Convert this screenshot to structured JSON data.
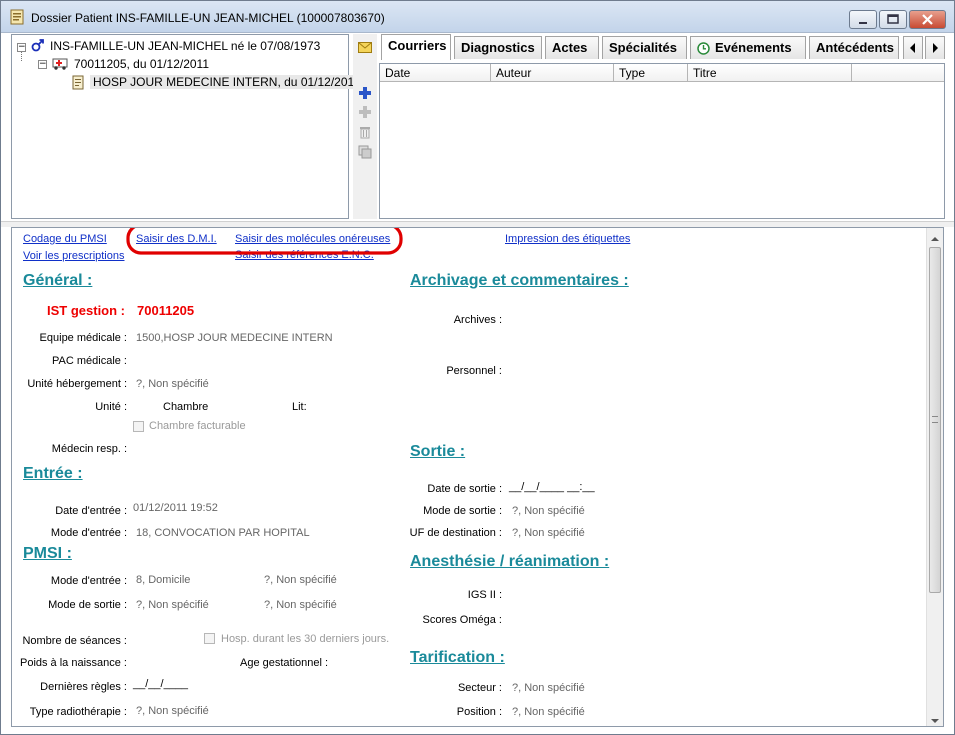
{
  "window": {
    "title": "Dossier Patient INS-FAMILLE-UN JEAN-MICHEL (100007803670)"
  },
  "tree": {
    "patient": "INS-FAMILLE-UN JEAN-MICHEL né le 07/08/1973",
    "stay": "70011205, du 01/12/2011",
    "unit": "HOSP JOUR MEDECINE INTERN, du 01/12/2011"
  },
  "tabs": [
    "Courriers",
    "Diagnostics",
    "Actes",
    "Spécialités",
    "Evénements",
    "Antécédents"
  ],
  "grid": {
    "columns": [
      "Date",
      "Auteur",
      "Type",
      "Titre"
    ]
  },
  "links": {
    "codage_pmsi": "Codage du PMSI",
    "voir_prescriptions": "Voir les prescriptions",
    "saisir_dmi": "Saisir des D.M.I.",
    "saisir_molecules": "Saisir des molécules onéreuses",
    "saisir_references": "Saisir des références E.N.C.",
    "impression_etiquettes": "Impression des étiquettes"
  },
  "general": {
    "heading": "Général :",
    "ist_label": "IST gestion :",
    "ist_value": "70011205",
    "equipe_label": "Equipe médicale :",
    "equipe_value": "1500,HOSP JOUR MEDECINE INTERN",
    "pac_label": "PAC médicale :",
    "unite_heb_label": "Unité hébergement :",
    "unite_heb_value": "?, Non spécifié",
    "unite_label": "Unité :",
    "unite_value": "Chambre",
    "lit_label": "Lit:",
    "chambre_facturable": "Chambre facturable",
    "medecin_label": "Médecin resp. :"
  },
  "entree": {
    "heading": "Entrée :",
    "date_label": "Date d'entrée :",
    "date_value": "01/12/2011 19:52",
    "mode_label": "Mode d'entrée :",
    "mode_value": "18, CONVOCATION PAR HOPITAL"
  },
  "pmsi": {
    "heading": "PMSI :",
    "mode_entree_label": "Mode d'entrée :",
    "mode_entree_value": "8, Domicile",
    "mode_entree_value2": "?, Non spécifié",
    "mode_sortie_label": "Mode de sortie :",
    "mode_sortie_value": "?, Non spécifié",
    "mode_sortie_value2": "?, Non spécifié",
    "seances_label": "Nombre de séances :",
    "hosp_30_label": "Hosp. durant les 30 derniers jours.",
    "poids_label": "Poids à la naissance :",
    "age_gest_label": "Age gestationnel :",
    "regles_label": "Dernières règles :",
    "regles_value": "__/__/____",
    "radio_label": "Type radiothérapie :",
    "radio_value": "?, Non spécifié"
  },
  "archivage": {
    "heading": "Archivage et commentaires :",
    "archives_label": "Archives :",
    "personnel_label": "Personnel :"
  },
  "sortie": {
    "heading": "Sortie :",
    "date_label": "Date de sortie :",
    "date_value": "__/__/____ __:__",
    "mode_label": "Mode de sortie :",
    "mode_value": "?, Non spécifié",
    "uf_label": "UF de destination :",
    "uf_value": "?, Non spécifié"
  },
  "anesthesie": {
    "heading": "Anesthésie / réanimation :",
    "igs_label": "IGS II :",
    "omega_label": "Scores Oméga :"
  },
  "tarification": {
    "heading": "Tarification :",
    "secteur_label": "Secteur :",
    "secteur_value": "?, Non spécifié",
    "position_label": "Position :",
    "position_value": "?, Non spécifié"
  },
  "colors": {
    "section": "#1a8a9a",
    "link": "#1030c8",
    "alert_red": "#e00000",
    "annotation_red": "#e00000"
  }
}
